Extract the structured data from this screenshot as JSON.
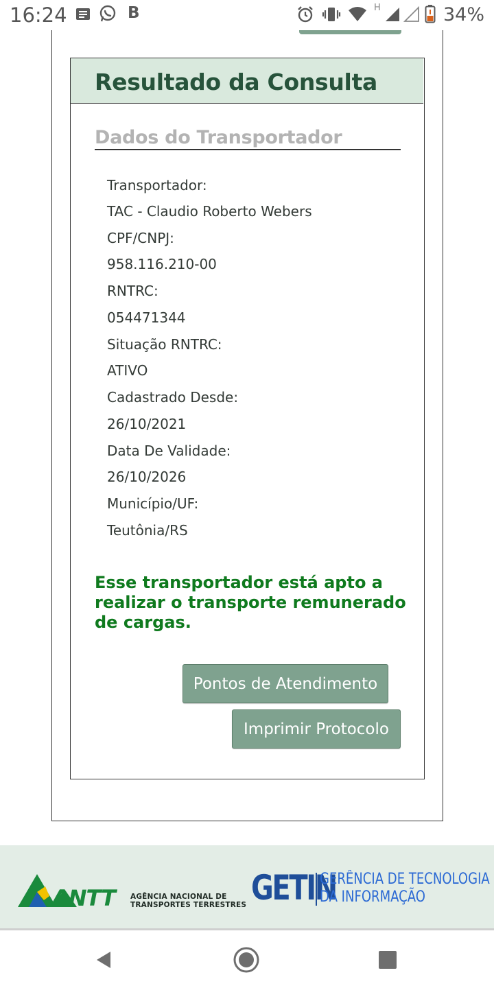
{
  "status_bar": {
    "time": "16:24",
    "notification_icons": [
      "message-icon",
      "whatsapp-icon",
      "b-app-icon"
    ],
    "system_icons": [
      "alarm-icon",
      "vibrate-icon",
      "wifi-icon",
      "signal-h-icon",
      "signal-empty-icon",
      "battery-icon"
    ],
    "network_label": "H",
    "battery": "34%"
  },
  "result": {
    "title": "Resultado da Consulta",
    "section_title": "Dados do Transportador",
    "fields": [
      {
        "label": "Transportador:",
        "value": "TAC - Claudio Roberto Webers"
      },
      {
        "label": "CPF/CNPJ:",
        "value": "958.116.210-00"
      },
      {
        "label": "RNTRC:",
        "value": "054471344"
      },
      {
        "label": "Situação RNTRC:",
        "value": "ATIVO"
      },
      {
        "label": "Cadastrado Desde:",
        "value": "26/10/2021"
      },
      {
        "label": "Data De Validade:",
        "value": "26/10/2026"
      },
      {
        "label": "Município/UF:",
        "value": "Teutônia/RS"
      }
    ],
    "message": "Esse transportador está apto a realizar o transporte remunerado de cargas.",
    "buttons": {
      "pontos": "Pontos de Atendimento",
      "imprimir": "Imprimir Protocolo"
    }
  },
  "footer": {
    "antt_logo_text": "ANTT",
    "antt_caption_line1": "AGÊNCIA NACIONAL DE",
    "antt_caption_line2": "TRANSPORTES TERRESTRES",
    "getin_logo_text": "GETIN",
    "getin_caption_line1": "GERÊNCIA DE TECNOLOGIA",
    "getin_caption_line2": "DA INFORMAÇÃO",
    "colors": {
      "antt_green": "#1a8a3c",
      "antt_yellow": "#f2c200",
      "antt_blue": "#1f5fb0",
      "getin_blue": "#1f4e99"
    }
  },
  "nav_bar": {
    "icons": [
      "back-icon",
      "home-icon",
      "recents-icon"
    ]
  },
  "colors": {
    "header_bg": "#d9e9dd",
    "title": "#27533b",
    "button_bg": "#7fa28f",
    "success_text": "#0f7a1e"
  }
}
